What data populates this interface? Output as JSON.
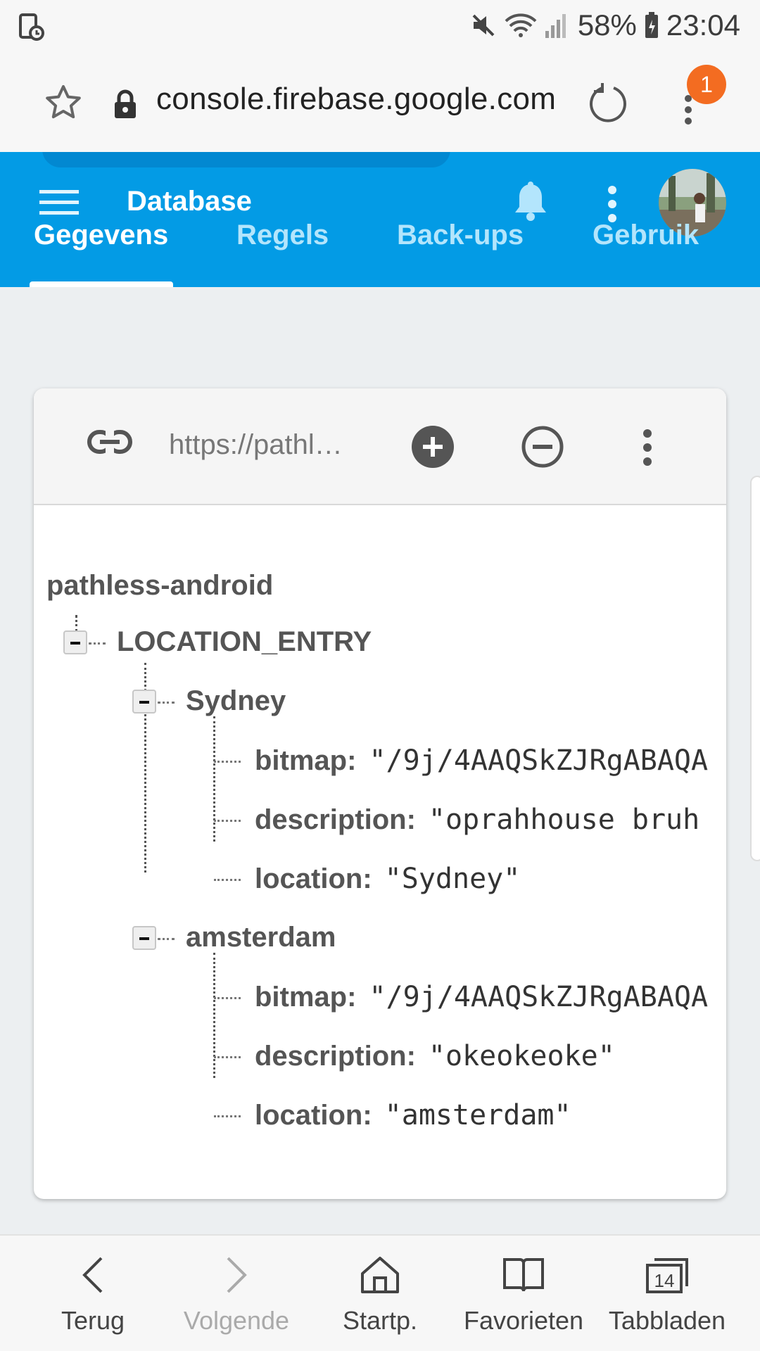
{
  "status_bar": {
    "battery_percent": "58%",
    "time": "23:04",
    "icons": [
      "screen-recorder-icon",
      "mute-icon",
      "wifi-icon",
      "signal-icon",
      "battery-icon"
    ]
  },
  "browser": {
    "url": "console.firebase.google.com",
    "notification_count": "1"
  },
  "app_bar": {
    "title": "Database",
    "tabs": [
      {
        "label": "Gegevens",
        "active": true
      },
      {
        "label": "Regels",
        "active": false
      },
      {
        "label": "Back-ups",
        "active": false
      },
      {
        "label": "Gebruik",
        "active": false
      }
    ],
    "accent": "#039be5"
  },
  "database": {
    "reference_url": "https://pathl…",
    "root": "pathless-android",
    "collection": "LOCATION_ENTRY",
    "entries": [
      {
        "key": "Sydney",
        "fields": [
          {
            "name": "bitmap:",
            "value": "\"/9j/4AAQSkZJRgABAQA"
          },
          {
            "name": "description:",
            "value": "\"oprahhouse bruh"
          },
          {
            "name": "location:",
            "value": "\"Sydney\""
          }
        ]
      },
      {
        "key": "amsterdam",
        "fields": [
          {
            "name": "bitmap:",
            "value": "\"/9j/4AAQSkZJRgABAQA"
          },
          {
            "name": "description:",
            "value": "\"okeokeoke\""
          },
          {
            "name": "location:",
            "value": "\"amsterdam\""
          }
        ]
      }
    ]
  },
  "bottom_nav": {
    "items": [
      {
        "label": "Terug",
        "icon": "back-icon"
      },
      {
        "label": "Volgende",
        "icon": "forward-icon"
      },
      {
        "label": "Startp.",
        "icon": "home-icon"
      },
      {
        "label": "Favorieten",
        "icon": "bookmarks-icon"
      },
      {
        "label": "Tabbladen",
        "icon": "tabs-icon",
        "count": "14"
      }
    ]
  }
}
